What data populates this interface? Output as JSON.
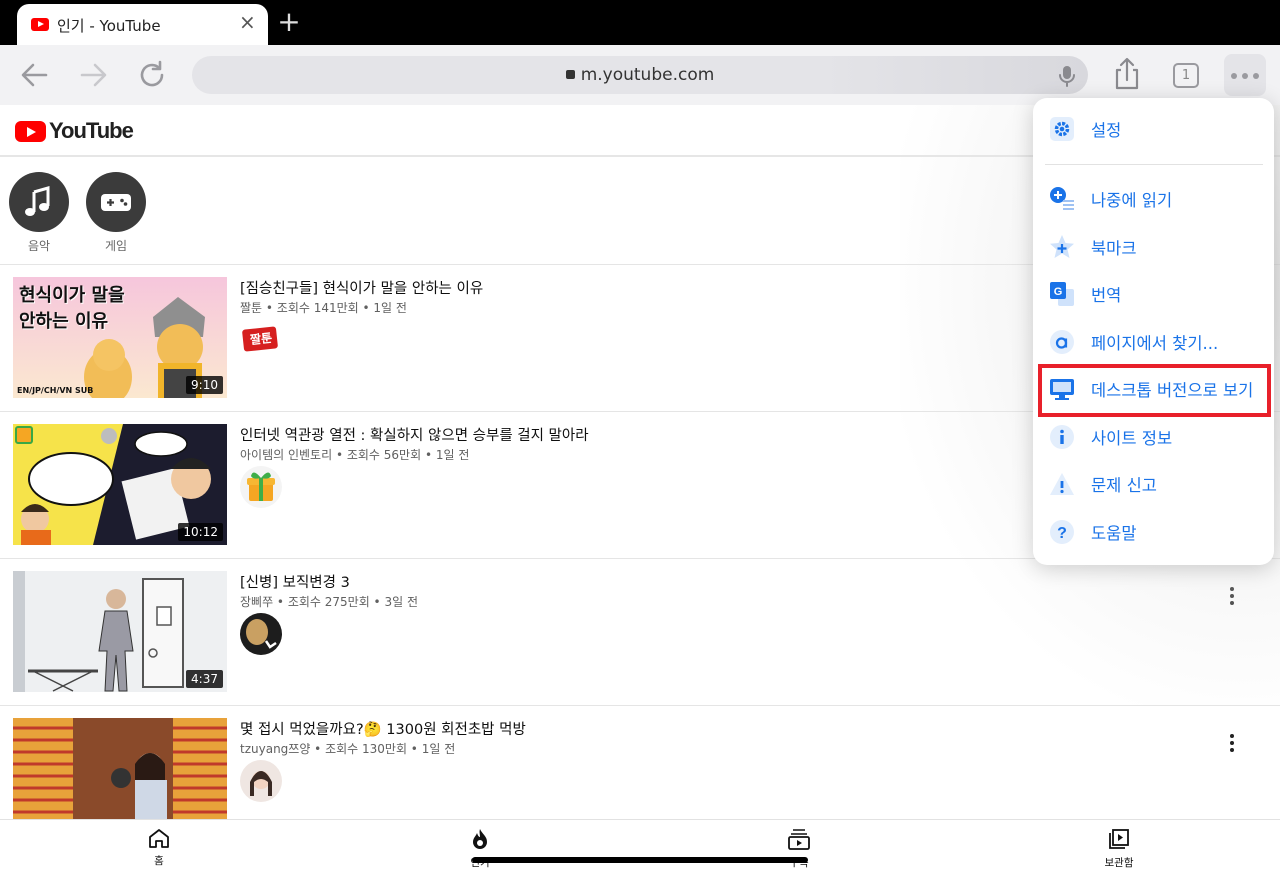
{
  "browser": {
    "tab_title": "인기 - YouTube",
    "close_glyph": "×",
    "new_tab_glyph": "+",
    "url": "m.youtube.com",
    "tab_count": "1"
  },
  "youtube": {
    "logo_text": "YouTube",
    "categories": [
      {
        "label": "음악",
        "icon": "music-note-icon"
      },
      {
        "label": "게임",
        "icon": "gamepad-icon"
      }
    ],
    "videos": [
      {
        "title": "[짐승친구들] 현식이가 말을 안하는 이유",
        "meta": "짤툰 • 조회수 141만회 • 1일 전",
        "duration": "9:10",
        "thumb_text": "현식이가 말을\n안하는 이유",
        "thumb_sub": "EN/JP/CH/VN SUB",
        "avatar_text": "짤툰"
      },
      {
        "title": "인터넷 역관광 열전 : 확실하지 않으면 승부를 걸지 말아라",
        "meta": "아이템의 인벤토리 • 조회수 56만회 • 1일 전",
        "duration": "10:12"
      },
      {
        "title": "[신병] 보직변경 3",
        "meta": "장삐쭈 • 조회수 275만회 • 3일 전",
        "duration": "4:37"
      },
      {
        "title": "몇 접시 먹었을까요?🤔 1300원 회전초밥 먹방",
        "meta": "tzuyang쯔양 • 조회수 130만회 • 1일 전",
        "duration": ""
      }
    ],
    "bottom_nav": [
      {
        "label": "홈",
        "icon": "home-icon"
      },
      {
        "label": "인기",
        "icon": "flame-icon"
      },
      {
        "label": "구독",
        "icon": "subscriptions-icon"
      },
      {
        "label": "보관함",
        "icon": "library-icon"
      }
    ]
  },
  "menu": {
    "items": [
      {
        "label": "설정",
        "icon": "gear-icon"
      },
      {
        "label": "나중에 읽기",
        "icon": "read-later-icon"
      },
      {
        "label": "북마크",
        "icon": "bookmark-star-icon"
      },
      {
        "label": "번역",
        "icon": "translate-icon"
      },
      {
        "label": "페이지에서 찾기...",
        "icon": "find-in-page-icon"
      },
      {
        "label": "데스크톱 버전으로 보기",
        "icon": "desktop-icon"
      },
      {
        "label": "사이트 정보",
        "icon": "info-icon"
      },
      {
        "label": "문제 신고",
        "icon": "warning-icon"
      },
      {
        "label": "도움말",
        "icon": "help-icon"
      }
    ],
    "highlighted_item": "데스크톱 버전으로 보기",
    "accent_color": "#1a73e8",
    "highlight_color": "#e8202a"
  }
}
